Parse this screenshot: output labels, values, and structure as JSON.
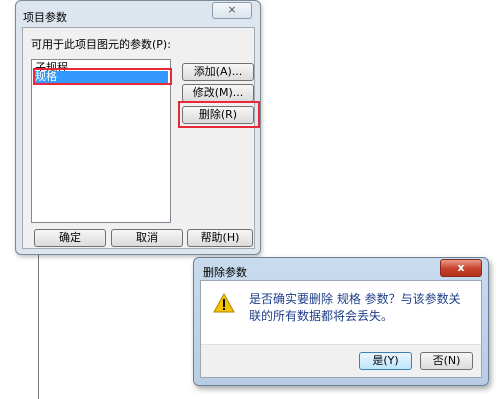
{
  "main_dialog": {
    "title": "项目参数",
    "close_label": "⨯",
    "caption": "可用于此项目图元的参数(P):",
    "list_items": [
      "子规程",
      "规格"
    ],
    "buttons": {
      "add": "添加(A)...",
      "modify": "修改(M)...",
      "delete": "删除(R)",
      "ok": "确定",
      "cancel": "取消",
      "help": "帮助(H)"
    }
  },
  "confirm_dialog": {
    "title": "删除参数",
    "close_label": "x",
    "message_line1": "是否确实要删除 规格 参数？与该参数关",
    "message_line2": "联的所有数据都将会丢失。",
    "yes_label": "是(Y)",
    "no_label": "否(N)"
  },
  "colors": {
    "selection": "#3399ff",
    "highlight_box": "#e8293a",
    "message_text": "#1f3d8a"
  }
}
